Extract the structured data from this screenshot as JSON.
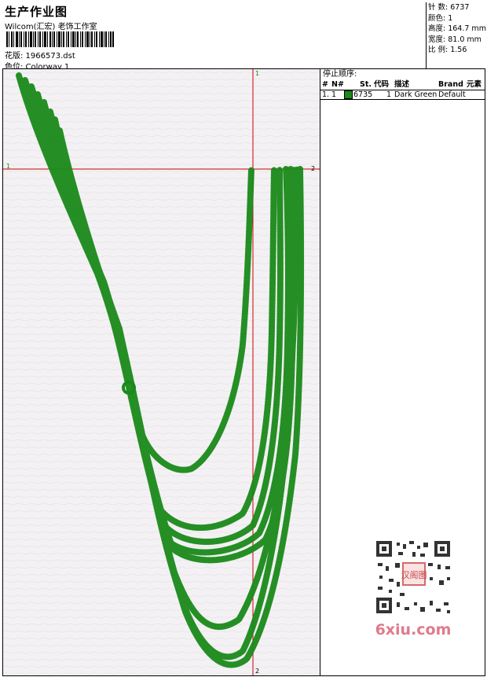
{
  "header": {
    "title": "生产作业图",
    "company": "Wilcom(汇宏) 老饰工作室",
    "design_line": "花版: 1966573.dst",
    "colorway_line": "色位: Colorway 1"
  },
  "stats": {
    "stitches": "针 数: 6737",
    "colors": "颜色: 1",
    "height": "高度: 164.7 mm",
    "width": "宽度: 81.0 mm",
    "scale": "比 例: 1.56"
  },
  "canvas": {
    "background": "#f3f1f3",
    "guide_color": "#cc0000",
    "stitch_color": "#1a8a1a",
    "marks": {
      "top": "1",
      "left": "1",
      "right": "2",
      "bottom": "2"
    }
  },
  "stop_sequence": {
    "title": "停止顺序:",
    "headers": [
      "#",
      "N#",
      "St.",
      "代码",
      "描述",
      "Brand",
      "元素"
    ],
    "rows": [
      {
        "index": "1.",
        "needle": "1",
        "stitches": "6735",
        "code": "1",
        "description": "Dark Green",
        "brand": "Default",
        "color": "#1a8a1a"
      }
    ]
  },
  "watermark": {
    "text": "6xiu.com",
    "stamp": "汉阁图"
  }
}
